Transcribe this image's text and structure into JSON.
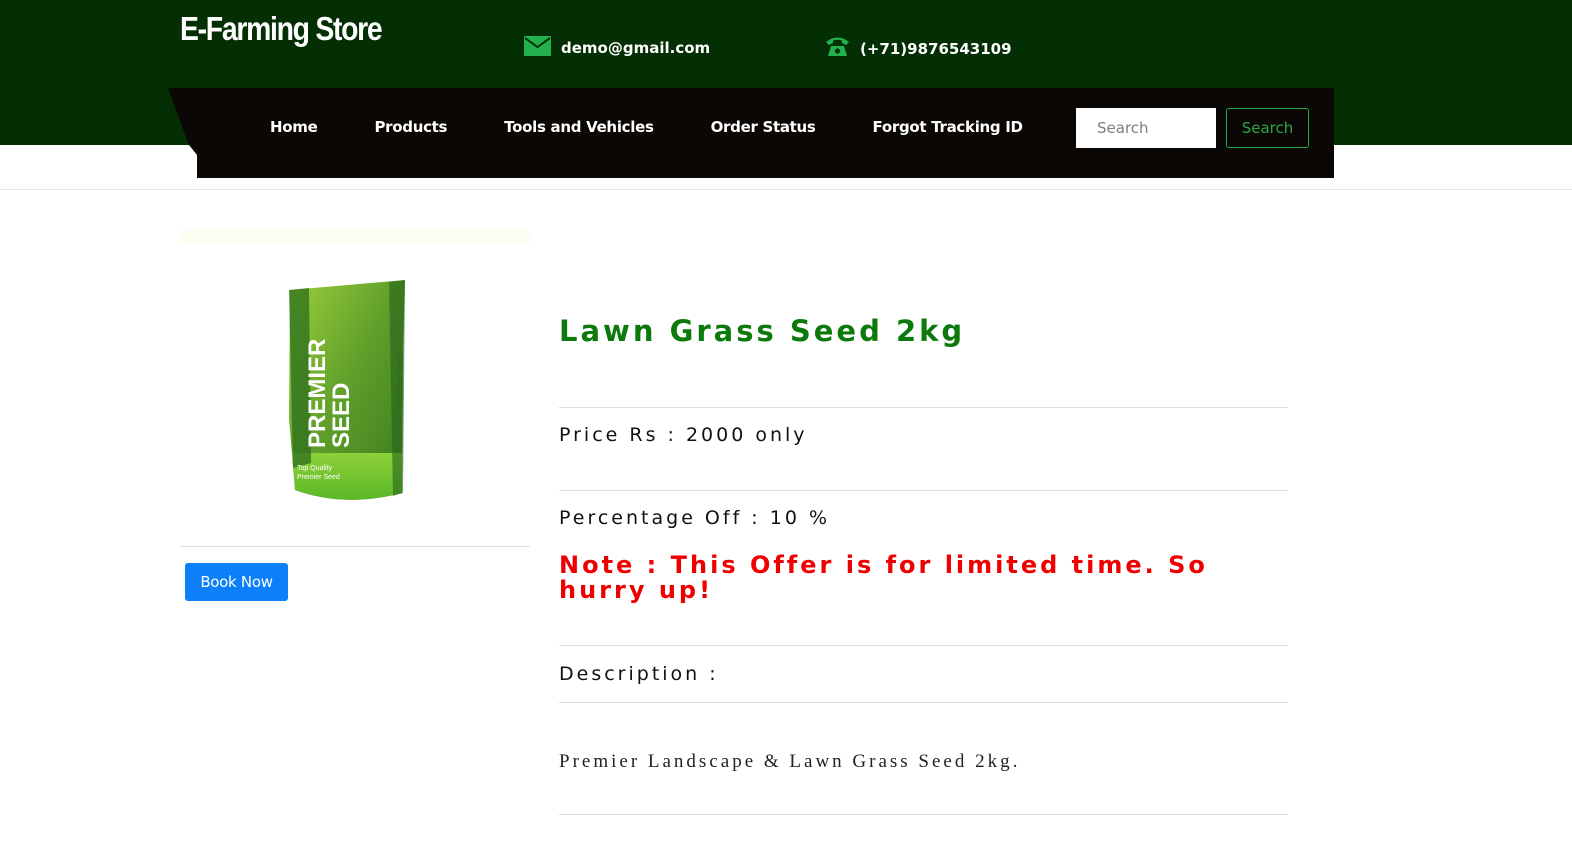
{
  "header": {
    "brand": "E-Farming Store",
    "email": "demo@gmail.com",
    "phone": "(+71)9876543109",
    "email_icon": "envelope-icon",
    "phone_icon": "telephone-icon"
  },
  "nav": {
    "items": [
      {
        "label": "Home"
      },
      {
        "label": "Products"
      },
      {
        "label": "Tools and Vehicles"
      },
      {
        "label": "Order Status"
      },
      {
        "label": "Forgot Tracking ID"
      }
    ],
    "search_placeholder": "Search",
    "search_button": "Search"
  },
  "product": {
    "image_brand_line1": "PREMIER",
    "image_brand_line2": "SEED",
    "image_side_text": "Premier Seed",
    "image_tag_line1": "Top Quality",
    "image_tag_line2": "Premier Seed",
    "book_button": "Book Now",
    "title": "Lawn Grass Seed 2kg",
    "price_line": "Price Rs : 2000 only",
    "discount_line": "Percentage Off : 10 %",
    "note": "Note : This Offer is for limited time. So hurry up!",
    "description_label": "Description :",
    "description": "Premier Landscape & Lawn Grass Seed 2kg."
  },
  "colors": {
    "header_bg": "#042f04",
    "nav_bg": "#0a0704",
    "title_green": "#0b7a0b",
    "note_red": "#ee0000",
    "book_blue": "#0d7ff8",
    "search_green": "#28a745",
    "icon_green": "#22b14c"
  }
}
